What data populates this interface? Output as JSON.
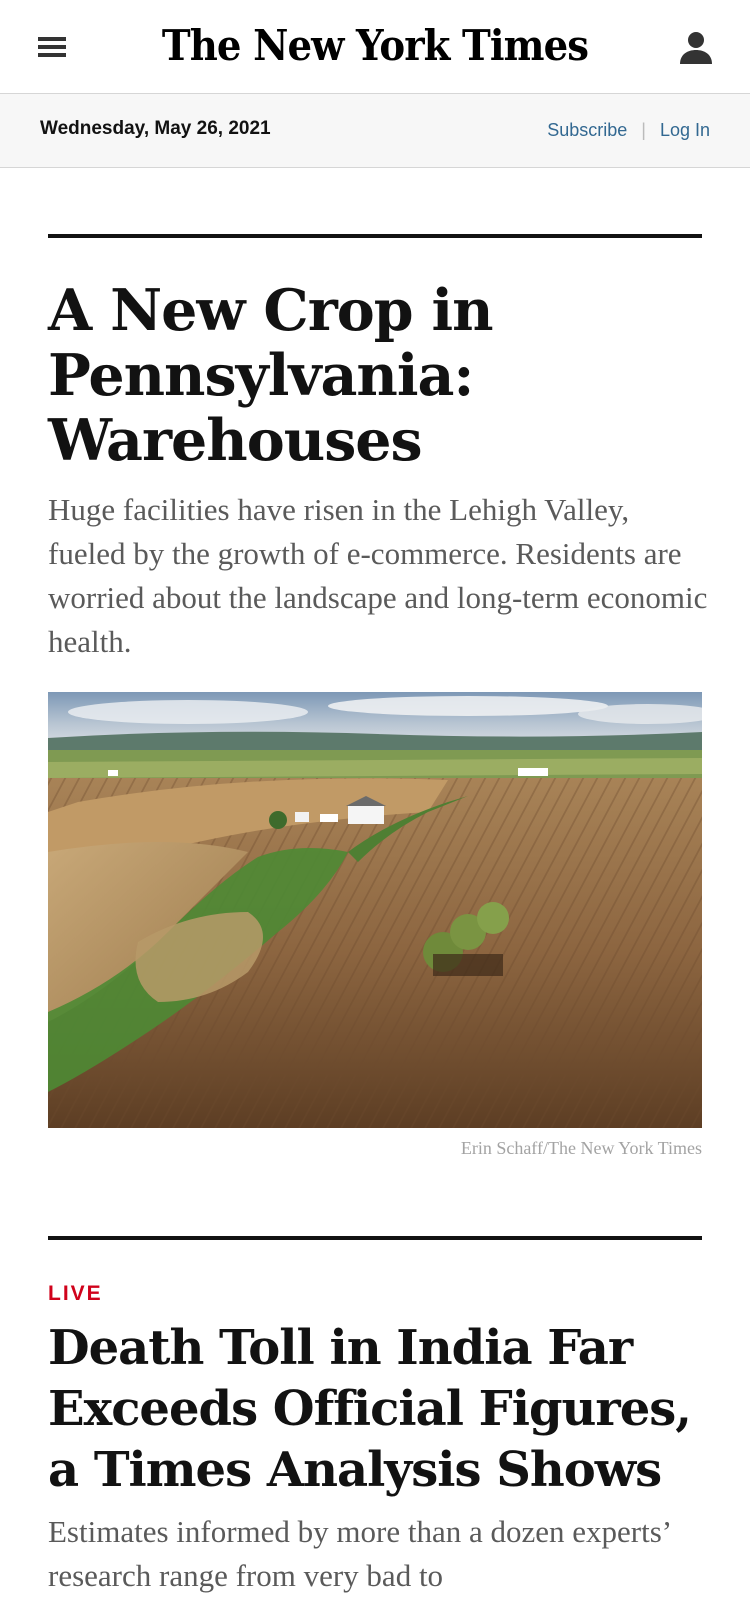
{
  "masthead": {
    "logo_text": "The New York Times"
  },
  "datebar": {
    "date": "Wednesday, May 26, 2021",
    "subscribe_label": "Subscribe",
    "separator": "|",
    "login_label": "Log In"
  },
  "stories": [
    {
      "headline": "A New Crop in Pennsylvania: Warehouses",
      "summary": "Huge facilities have risen in the Lehigh Valley, fueled by the growth of e-commerce. Residents are worried about the landscape and long-term economic health.",
      "image_credit": "Erin Schaff/The New York Times"
    },
    {
      "kicker": "LIVE",
      "headline": "Death Toll in India Far Exceeds Official Figures, a Times Analysis Shows",
      "summary": "Estimates informed by more than a dozen experts’ research range from very bad to"
    }
  ],
  "colors": {
    "link": "#326891",
    "live": "#d0021b",
    "text": "#121212",
    "summary": "#5a5a5a"
  },
  "icons": {
    "menu": "hamburger-icon",
    "account": "user-icon"
  }
}
